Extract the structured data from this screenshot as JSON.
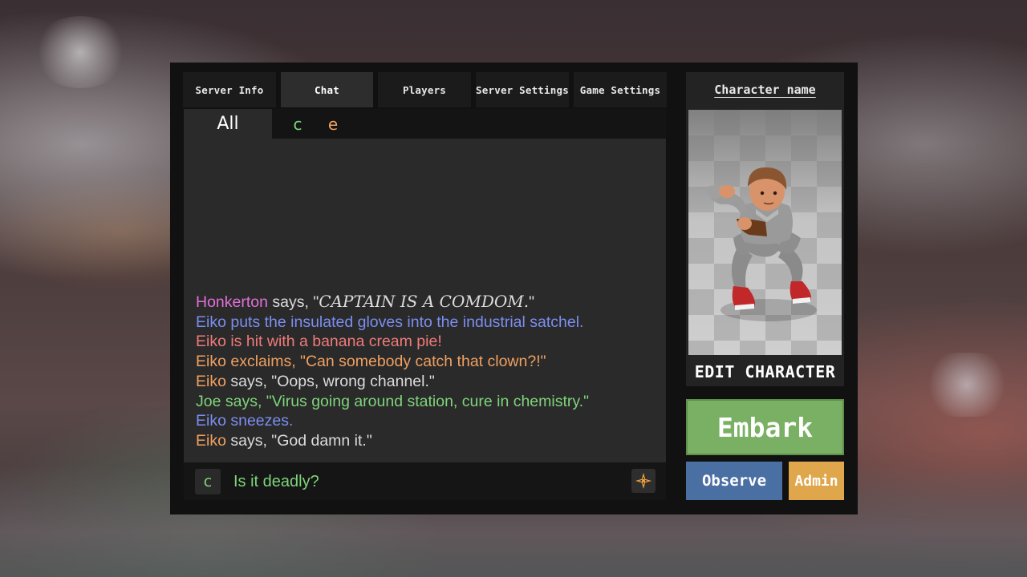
{
  "tabs": [
    {
      "label": "Server Info"
    },
    {
      "label": "Chat"
    },
    {
      "label": "Players"
    },
    {
      "label": "Server Settings"
    },
    {
      "label": "Game Settings"
    }
  ],
  "active_tab": "Chat",
  "channels": {
    "all_label": "All",
    "c_label": "c",
    "e_label": "e"
  },
  "messages": [
    {
      "speaker": "Honkerton",
      "verb": " says, \"",
      "quote": "CAPTAIN IS A COMDOM.",
      "end": "\""
    },
    {
      "text": "Eiko puts the insulated gloves into the industrial satchel."
    },
    {
      "text": "Eiko is hit with a banana cream pie!"
    },
    {
      "text": "Eiko exclaims, \"Can somebody catch that clown?!\""
    },
    {
      "speaker": "Eiko",
      "rest": " says, \"Oops, wrong channel.\""
    },
    {
      "text": "Joe says, \"Virus going around station, cure in chemistry.\""
    },
    {
      "text": "Eiko sneezes."
    },
    {
      "speaker": "Eiko",
      "rest": " says, \"God damn it.\""
    }
  ],
  "input": {
    "channel_prefix": "c",
    "value": "Is it deadly?"
  },
  "character": {
    "name_label": "Character name",
    "edit_label": "EDIT CHARACTER"
  },
  "buttons": {
    "embark": "Embark",
    "observe": "Observe",
    "admin": "Admin"
  },
  "colors": {
    "green": "#7ed47a",
    "orange": "#f0a060",
    "pink": "#e070d8",
    "blue": "#7b8ef0",
    "red": "#f07a7a",
    "text": "#dcdcdc",
    "embark": "#79b063",
    "observe": "#4a6fa3",
    "admin": "#e0a64c"
  }
}
